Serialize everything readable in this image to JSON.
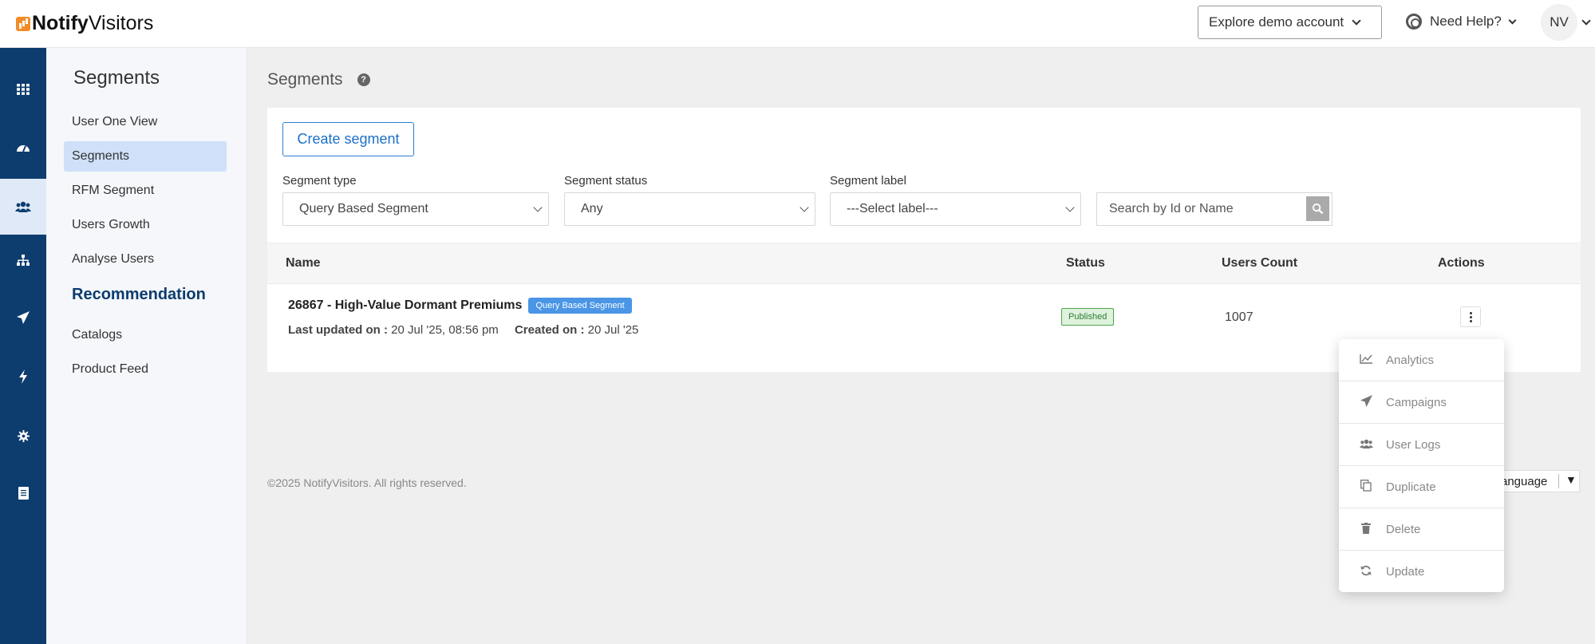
{
  "header": {
    "logo_bold": "Notify",
    "logo_light": "Visitors",
    "explore_label": "Explore demo account",
    "help_label": "Need Help?",
    "avatar_initials": "NV"
  },
  "rail": {
    "icons": [
      "grid-icon",
      "dashboard-icon",
      "users-icon",
      "sitemap-icon",
      "send-icon",
      "bolt-icon",
      "gear-icon",
      "document-icon"
    ],
    "active_index": 2
  },
  "subnav": {
    "title": "Segments",
    "items": [
      "User One View",
      "Segments",
      "RFM Segment",
      "Users Growth",
      "Analyse Users"
    ],
    "recommendation_heading": "Recommendation",
    "recommendation_items": [
      "Catalogs",
      "Product Feed"
    ]
  },
  "main": {
    "page_title": "Segments",
    "create_label": "Create segment",
    "filters": {
      "type_label": "Segment type",
      "type_value": "Query Based Segment",
      "status_label": "Segment status",
      "status_value": "Any",
      "label_label": "Segment label",
      "label_value": "---Select label---",
      "search_placeholder": "Search by Id or Name"
    },
    "table": {
      "headers": [
        "Name",
        "Status",
        "Users Count",
        "Actions"
      ],
      "row": {
        "name": "26867 - High-Value Dormant Premiums",
        "badge": "Query Based Segment",
        "updated_label": "Last updated on :",
        "updated_value": "20 Jul '25, 08:56 pm",
        "created_label": "Created on :",
        "created_value": "20 Jul '25",
        "status": "Published",
        "users_count": "1007"
      }
    },
    "footer": "©2025 NotifyVisitors. All rights reserved.",
    "language_label": "anguage",
    "language_arrow": "▼"
  },
  "actions_menu": [
    {
      "label": "Analytics",
      "icon": "chart-line-icon"
    },
    {
      "label": "Campaigns",
      "icon": "paper-plane-icon"
    },
    {
      "label": "User Logs",
      "icon": "users-icon"
    },
    {
      "label": "Duplicate",
      "icon": "copy-icon"
    },
    {
      "label": "Delete",
      "icon": "trash-icon"
    },
    {
      "label": "Update",
      "icon": "refresh-icon"
    }
  ],
  "colors": {
    "rail_bg": "#0d3c6e",
    "accent": "#1c6fc9",
    "badge_bg": "#4a95e6",
    "status_published": "#2e7d32"
  }
}
